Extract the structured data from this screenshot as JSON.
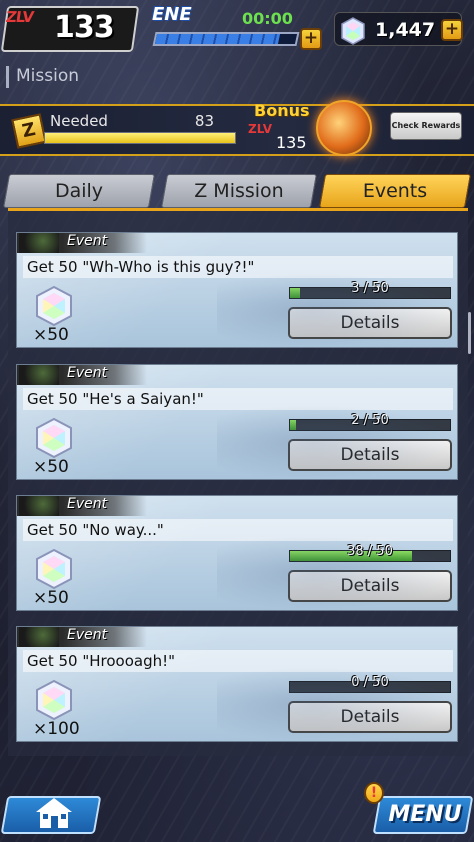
{
  "header": {
    "zlv_tag": "ZLV",
    "player_level": "133",
    "ene_label": "ENE",
    "ene_timer": "00:00",
    "ene_fill_percent": 88,
    "gem_count": "1,447",
    "plus": "+"
  },
  "page": {
    "title": "Mission"
  },
  "bonus_banner": {
    "needed_label": "Needed",
    "needed_value": "83",
    "needed_fill_percent": 100,
    "bonus_label": "Bonus",
    "bonus_zlv": "ZLV",
    "bonus_level": "135",
    "check_rewards_label": "Check Rewards"
  },
  "tabs": [
    {
      "label": "Daily",
      "active": false
    },
    {
      "label": "Z Mission",
      "active": false
    },
    {
      "label": "Events",
      "active": true
    }
  ],
  "missions": [
    {
      "tag": "Event",
      "text": "Get 50 \"Wh-Who is this guy?!\"",
      "reward_qty": "×50",
      "progress_text": "3 / 50",
      "progress_fraction": 0.06,
      "details_label": "Details"
    },
    {
      "tag": "Event",
      "text": "Get 50 \"He's a Saiyan!\"",
      "reward_qty": "×50",
      "progress_text": "2 / 50",
      "progress_fraction": 0.04,
      "details_label": "Details"
    },
    {
      "tag": "Event",
      "text": "Get 50 \"No way...\"",
      "reward_qty": "×50",
      "progress_text": "38 / 50",
      "progress_fraction": 0.76,
      "details_label": "Details"
    },
    {
      "tag": "Event",
      "text": "Get 50 \"Hroooagh!\"",
      "reward_qty": "×100",
      "progress_text": "0 / 50",
      "progress_fraction": 0.0,
      "details_label": "Details"
    }
  ],
  "footer": {
    "menu_label": "MENU",
    "alert_glyph": "!"
  },
  "icons": {
    "gem": "chrono-crystal-icon",
    "home": "home-icon",
    "menu": "menu-icon"
  }
}
